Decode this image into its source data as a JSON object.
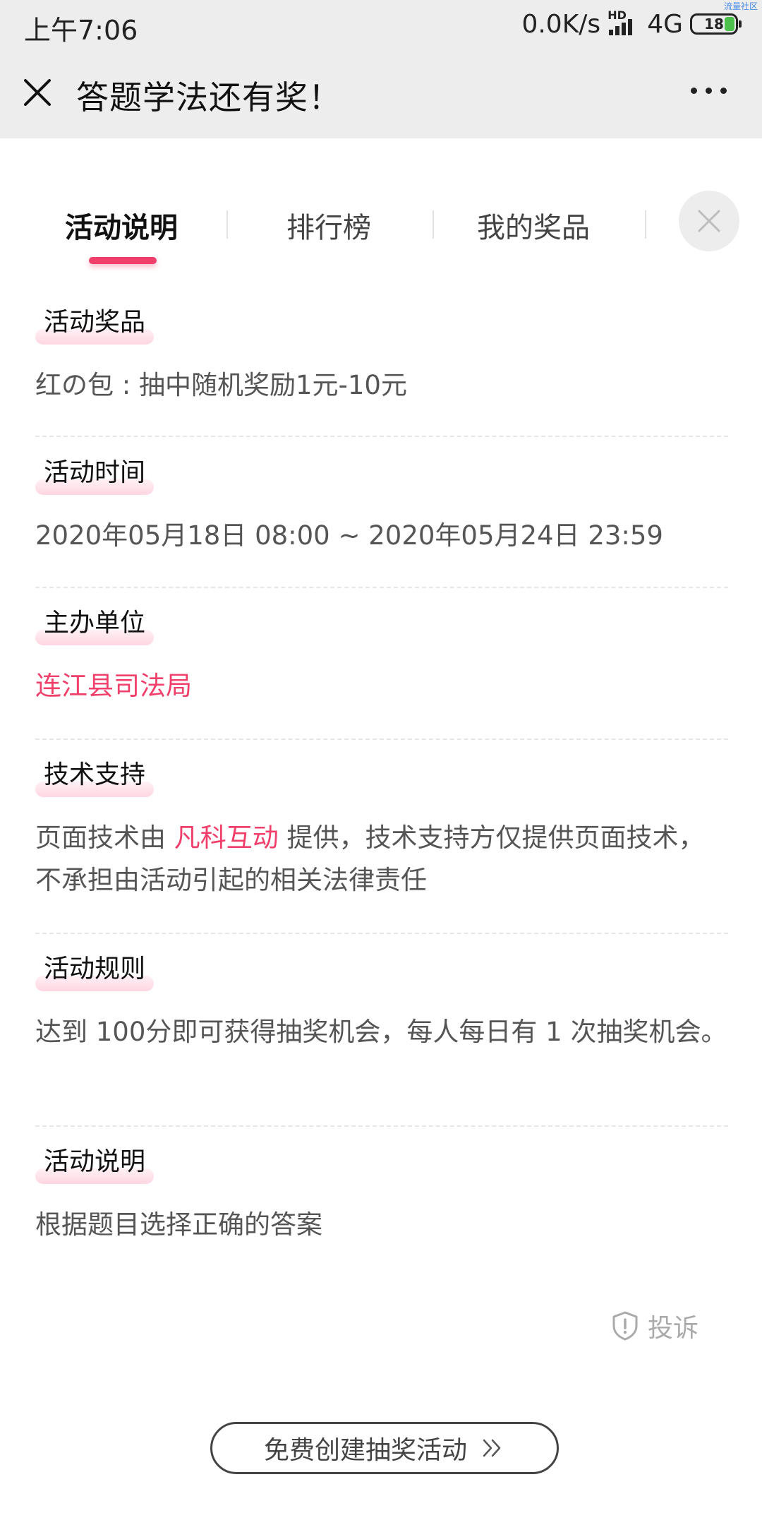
{
  "status_bar": {
    "time": "上午7:06",
    "net_speed": "0.0K/s",
    "hd_label": "HD",
    "network": "4G",
    "battery": "18",
    "corner_tag": "流量社区"
  },
  "nav": {
    "title": "答题学法还有奖！",
    "close_icon": "close-icon",
    "more_icon": "more-icon"
  },
  "tabs": [
    {
      "label": "活动说明",
      "active": true
    },
    {
      "label": "排行榜",
      "active": false
    },
    {
      "label": "我的奖品",
      "active": false
    }
  ],
  "sections": [
    {
      "tag": "活动奖品",
      "body": "红の包 : 抽中随机奖励1元-10元"
    },
    {
      "tag": "活动时间",
      "body": "2020年05月18日 08:00 ~ 2020年05月24日 23:59"
    },
    {
      "tag": "主办单位",
      "body": "连江县司法局"
    },
    {
      "tag": "技术支持",
      "body_prefix": "页面技术由 ",
      "body_highlight": "凡科互动",
      "body_suffix": " 提供，技术支持方仅提供页面技术，不承担由活动引起的相关法律责任"
    },
    {
      "tag": "活动规则",
      "body": "达到 100分即可获得抽奖机会，每人每日有 1 次抽奖机会。"
    },
    {
      "tag": "活动说明",
      "body": "根据题目选择正确的答案"
    }
  ],
  "complaint": {
    "label": "投诉"
  },
  "create_button": {
    "label": "免费创建抽奖活动"
  },
  "colors": {
    "accent": "#ef3f6a",
    "tag_highlight": "#ffd6e2",
    "nav_bg": "#ededed"
  }
}
